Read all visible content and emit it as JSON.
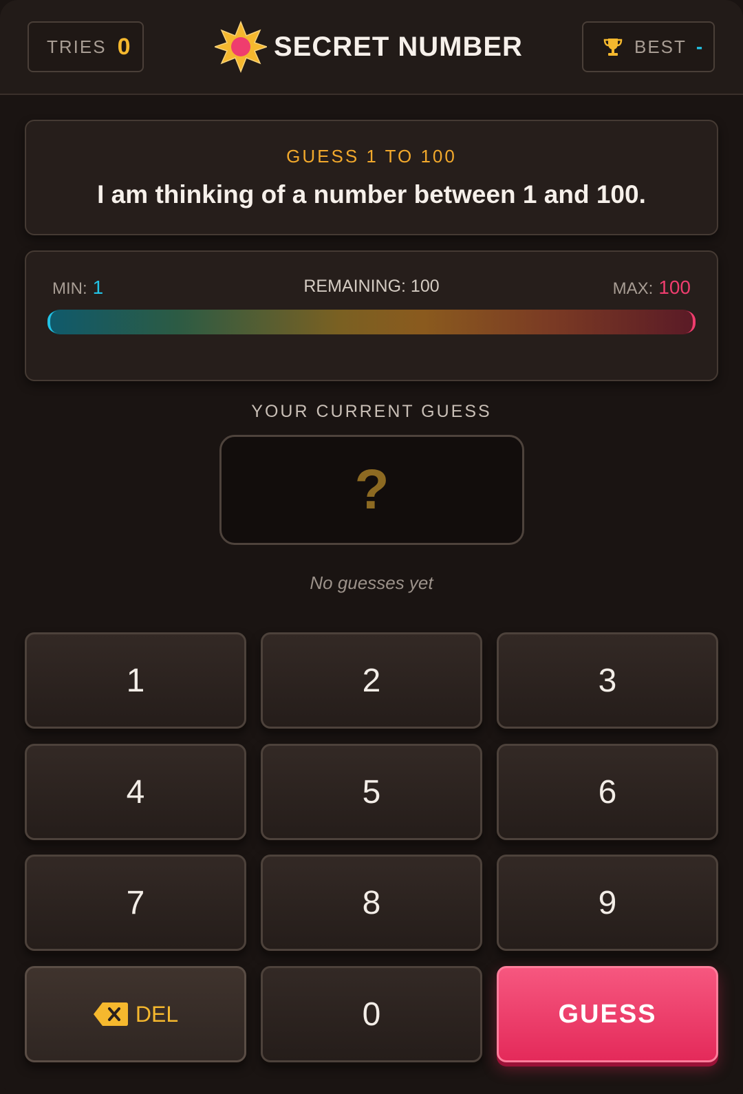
{
  "header": {
    "tries_label": "TRIES",
    "tries_value": "0",
    "title": "SECRET NUMBER",
    "best_label": "BEST",
    "best_value": "-"
  },
  "message": {
    "hint": "GUESS 1 TO 100",
    "text": "I am thinking of a number between 1 and 100."
  },
  "range": {
    "min_label": "MIN:",
    "min_value": "1",
    "remaining_text": "REMAINING: 100",
    "max_label": "MAX:",
    "max_value": "100",
    "fill_fraction": 1.0
  },
  "guess": {
    "label": "YOUR CURRENT GUESS",
    "display": "?",
    "status": "No guesses yet"
  },
  "keypad": {
    "keys": [
      "1",
      "2",
      "3",
      "4",
      "5",
      "6",
      "7",
      "8",
      "9"
    ],
    "zero": "0",
    "delete_label": "DEL",
    "guess_label": "GUESS"
  },
  "colors": {
    "accent_gold": "#f5b82e",
    "accent_cyan": "#22c3e6",
    "accent_pink": "#ef3d6e",
    "guess_button": "#e42a5a"
  },
  "icons": {
    "title_icon": "sun-icon",
    "best_icon": "trophy-icon",
    "delete_icon": "backspace-icon"
  }
}
